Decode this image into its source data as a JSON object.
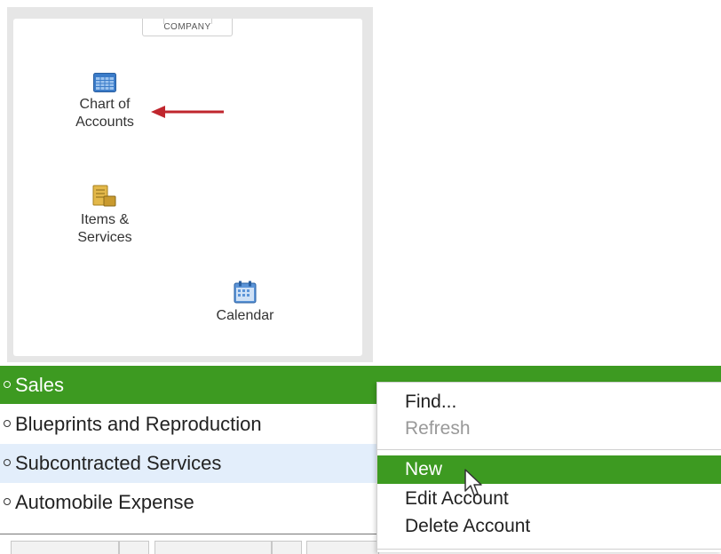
{
  "company_panel": {
    "tab_label": "COMPANY",
    "icons": {
      "chart_of_accounts": {
        "line1": "Chart of",
        "line2": "Accounts",
        "icon": "ledger-icon"
      },
      "items_services": {
        "line1": "Items &",
        "line2": "Services",
        "icon": "items-icon"
      },
      "calendar": {
        "label": "Calendar",
        "icon": "calendar-icon"
      }
    },
    "annotation_arrow_color": "#c0262d"
  },
  "account_list": {
    "rows": [
      {
        "label": "Sales",
        "state": "selected"
      },
      {
        "label": "Blueprints and Reproduction",
        "state": "normal"
      },
      {
        "label": "Subcontracted Services",
        "state": "hover"
      },
      {
        "label": "Automobile Expense",
        "state": "normal"
      }
    ],
    "selected_color": "#3d9a21",
    "hover_color": "#e3eefb"
  },
  "context_menu": {
    "items": [
      {
        "label": "Find...",
        "enabled": true
      },
      {
        "label": "Refresh",
        "enabled": false
      },
      {
        "label": "New",
        "enabled": true,
        "highlighted": true
      },
      {
        "label": "Edit Account",
        "enabled": true
      },
      {
        "label": "Delete Account",
        "enabled": true
      }
    ]
  }
}
